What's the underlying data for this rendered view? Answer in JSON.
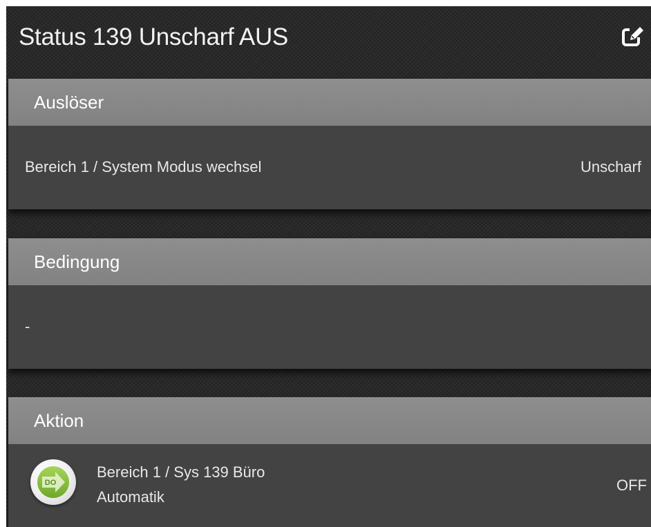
{
  "header": {
    "title": "Status 139 Unscharf AUS",
    "edit_icon": "edit-icon"
  },
  "trigger": {
    "heading": "Auslöser",
    "label": "Bereich 1 / System Modus wechsel",
    "value": "Unscharf"
  },
  "condition": {
    "heading": "Bedingung",
    "label": "-"
  },
  "action": {
    "heading": "Aktion",
    "icon": "do-arrow-icon",
    "icon_text": "DO",
    "line1": "Bereich 1 / Sys 139 Büro",
    "line2": "Automatik",
    "value": "OFF"
  },
  "colors": {
    "background": "#2a2a2a",
    "card_header": "#8a8a8a",
    "card_body": "#434343",
    "text": "#f2f2f2",
    "do_icon_green": "#8cc63f"
  }
}
